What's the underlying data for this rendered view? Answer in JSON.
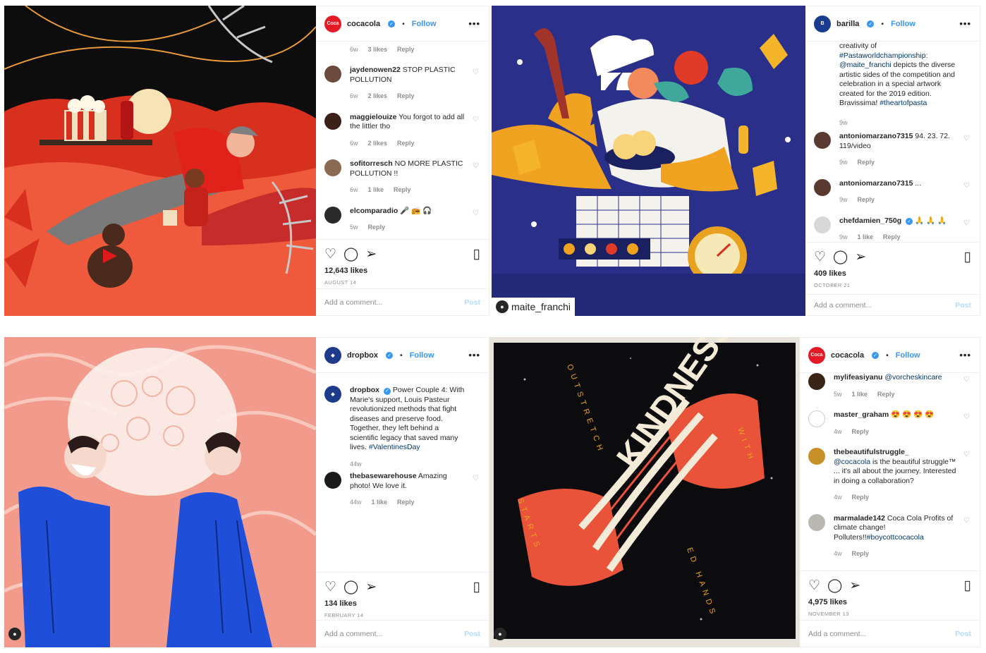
{
  "posts": [
    {
      "username": "cocacola",
      "verified": true,
      "follow": "Follow",
      "more": "•••",
      "avatar_color": "#e61a27",
      "comments": [
        {
          "meta": [
            "6w",
            "3 likes",
            "Reply"
          ]
        },
        {
          "user": "jaydenowen22",
          "text": "STOP PLASTIC POLLUTION",
          "meta": [
            "6w",
            "2 likes",
            "Reply"
          ]
        },
        {
          "user": "maggielouize",
          "text": "You forgot to add all the littler tho",
          "meta": [
            "6w",
            "2 likes",
            "Reply"
          ]
        },
        {
          "user": "sofitorresch",
          "text": "NO MORE PLASTIC POLLUTION !!",
          "meta": [
            "6w",
            "1 like",
            "Reply"
          ]
        },
        {
          "user": "elcomparadio",
          "text": "🎤 📻 🎧",
          "meta": [
            "5w",
            "Reply"
          ]
        }
      ],
      "likes": "12,643 likes",
      "date": "AUGUST 14",
      "add_comment": "Add a comment...",
      "post": "Post"
    },
    {
      "username": "barilla",
      "verified": true,
      "follow": "Follow",
      "more": "•••",
      "avatar_color": "#1a3c8f",
      "caption_parts": [
        "creativity of ",
        "#Pastaworldchampionship:",
        " ",
        "@maite_franchi",
        " depicts the diverse artistic sides of the competition and celebration in a special artwork created for the 2019 edition. Bravissima! ",
        "#theartofpasta"
      ],
      "caption_time": "9w",
      "comments": [
        {
          "user": "antoniomarzano7315",
          "text": "94. 23. 72. 119/video",
          "meta": [
            "9w",
            "Reply"
          ]
        },
        {
          "user": "antoniomarzano7315",
          "text": "...",
          "meta": [
            "9w",
            "Reply"
          ]
        },
        {
          "user": "chefdamien_750g",
          "text": "🙏 🙏 🙏",
          "meta": [
            "9w",
            "1 like",
            "Reply"
          ]
        }
      ],
      "likes": "409 likes",
      "date": "OCTOBER 21",
      "add_comment": "Add a comment...",
      "post": "Post",
      "image_tag": "maite_franchi"
    },
    {
      "username": "dropbox",
      "verified": true,
      "follow": "Follow",
      "more": "•••",
      "avatar_color": "#1e3a8a",
      "caption_user": "dropbox",
      "caption_text": "Power Couple 4: With Marie's support, Louis Pasteur revolutionized methods that fight diseases and preserve food. Together, they left behind a scientific legacy that saved many lives.",
      "caption_tag": "#ValentinesDay",
      "caption_time": "44w",
      "comments": [
        {
          "user": "thebasewarehouse",
          "text": "Amazing photo! We love it.",
          "meta": [
            "44w",
            "1 like",
            "Reply"
          ]
        }
      ],
      "likes": "134 likes",
      "date": "FEBRUARY 14",
      "add_comment": "Add a comment...",
      "post": "Post"
    },
    {
      "username": "cocacola",
      "verified": true,
      "follow": "Follow",
      "more": "•••",
      "avatar_color": "#e61a27",
      "comments": [
        {
          "user": "mylifeasiyanu",
          "mention": "@vorcheskincare",
          "meta": [
            "5w",
            "1 like",
            "Reply"
          ]
        },
        {
          "user": "master_graham",
          "text": "😍 😍 😍 😍",
          "meta": [
            "4w",
            "Reply"
          ]
        },
        {
          "user": "thebeautifulstruggle_",
          "mention": "@cocacola",
          "text": " is the beautiful struggle™ ... it's all about the journey. Interested in doing a collaboration?",
          "meta": [
            "4w",
            "Reply"
          ]
        },
        {
          "user": "marmalade142",
          "text": "Coca Cola Profits of climate change! Polluters!!",
          "tag": "#boycottcocacola",
          "meta": [
            "4w",
            "Reply"
          ]
        }
      ],
      "likes": "4,975 likes",
      "date": "NOVEMBER 13",
      "add_comment": "Add a comment...",
      "post": "Post",
      "art_words": {
        "top": "OUTSTRETCH",
        "right": "WITH",
        "left": "STARTS",
        "bottom": "ED HANDS",
        "center": "KINDNESS"
      }
    }
  ],
  "colors": {
    "link": "#00376b",
    "blue": "#3897f0",
    "grey": "#8e8e8e"
  }
}
